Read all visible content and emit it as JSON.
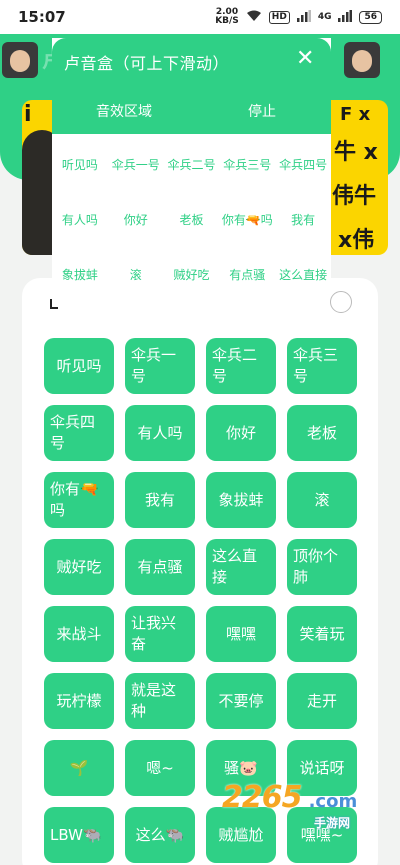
{
  "status_bar": {
    "time": "15:07",
    "speed_value": "2.00",
    "speed_unit": "KB/S",
    "sim_label": "HD",
    "network": "4G",
    "battery": "56"
  },
  "header": {
    "bg_text": "卢音"
  },
  "popup": {
    "title": "卢音盒（可上下滑动）",
    "close_icon": "close-icon",
    "tabs": [
      "音效区域",
      "停止"
    ],
    "rows": [
      [
        "听见吗",
        "伞兵一号",
        "伞兵二号",
        "伞兵三号",
        "伞兵四号"
      ],
      [
        "有人吗",
        "你好",
        "老板",
        "你有🔫吗",
        "我有"
      ],
      [
        "象拔蚌",
        "滚",
        "贼好吃",
        "有点骚",
        "这么直接"
      ]
    ]
  },
  "sound_buttons": [
    "听见吗",
    "伞兵一号",
    "伞兵二号",
    "伞兵三号",
    "伞兵四号",
    "有人吗",
    "你好",
    "老板",
    "你有🔫吗",
    "我有",
    "象拔蚌",
    "滚",
    "贼好吃",
    "有点骚",
    "这么直接",
    "顶你个肺",
    "来战斗",
    "让我兴奋",
    "嘿嘿",
    "笑着玩",
    "玩柠檬",
    "就是这种",
    "不要停",
    "走开",
    "🌱",
    "嗯~",
    "骚🐷",
    "说话呀",
    "LBW🐃",
    "这么🐃",
    "贼尴尬",
    "嘿嘿~"
  ],
  "watermark": {
    "logo": "2265",
    "suffix": ".com",
    "sub": "手游网"
  },
  "colors": {
    "accent": "#2fd086",
    "banner": "#fbd500"
  }
}
